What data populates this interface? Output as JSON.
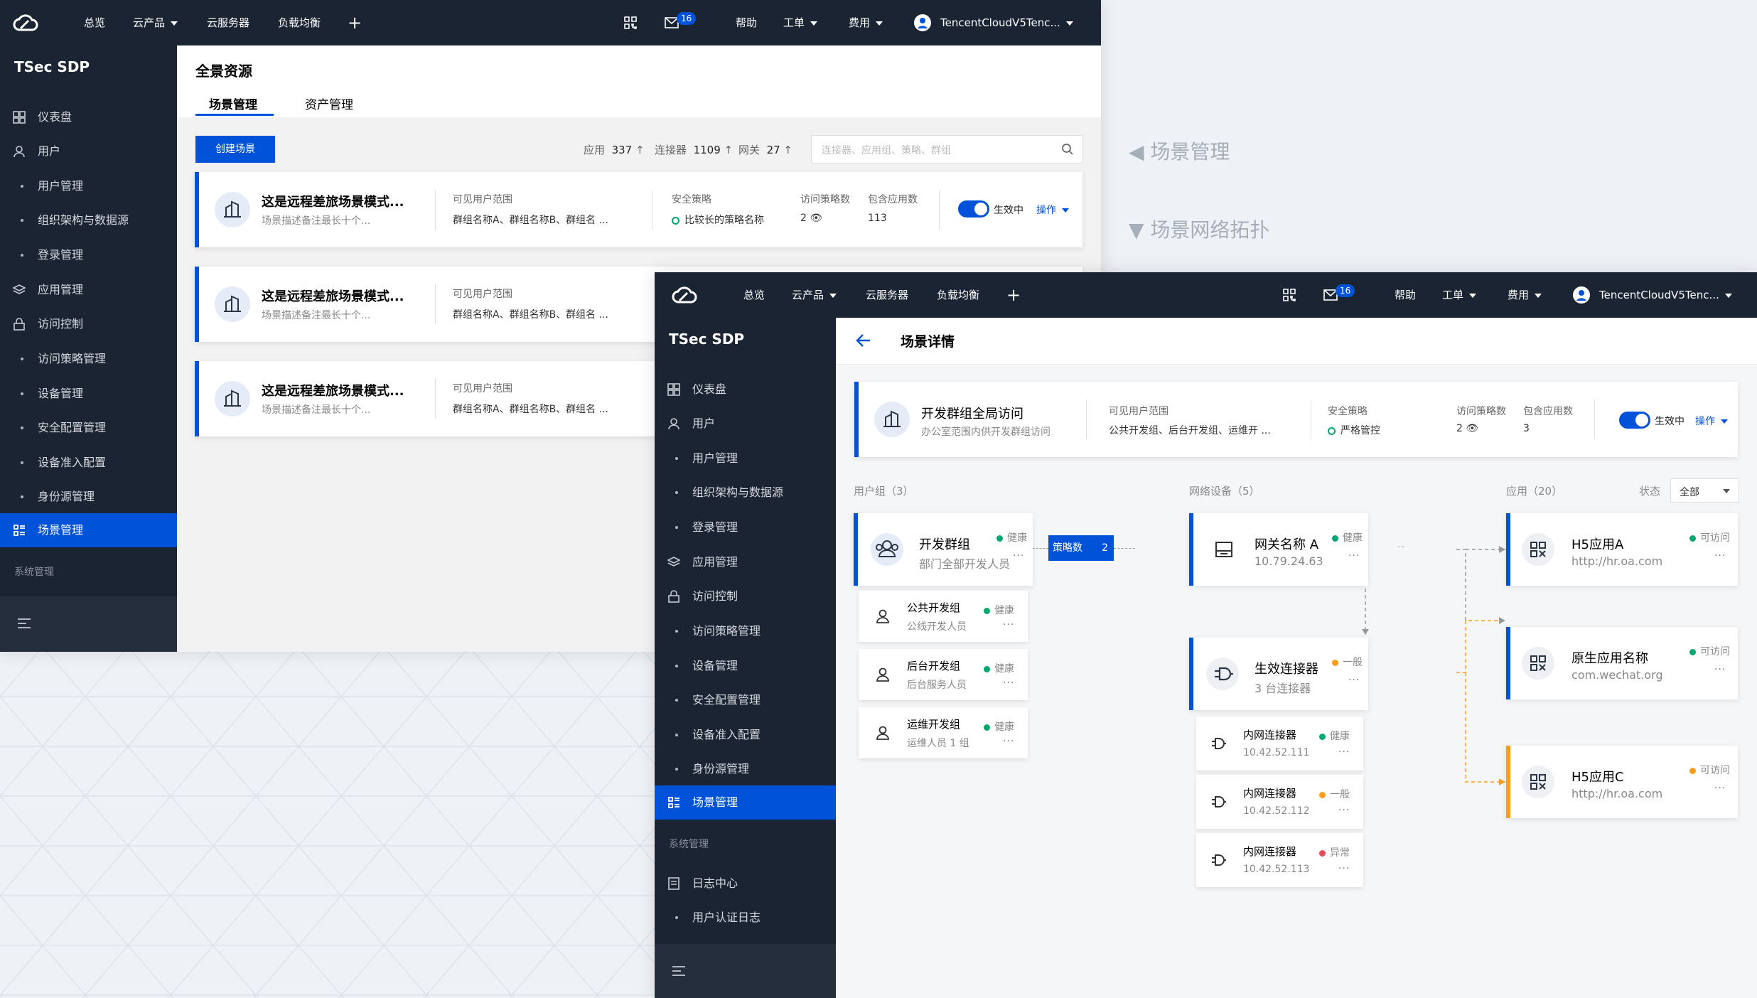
{
  "notes": {
    "scene_mgmt": "◀ 场景管理",
    "topology": "▼ 场景网络拓扑"
  },
  "topbar": {
    "overview": "总览",
    "products": "云产品",
    "servers": "云服务器",
    "lb": "负载均衡",
    "mail_count": "16",
    "help": "帮助",
    "tickets": "工单",
    "fees": "费用",
    "account": "TencentCloudV5Tenc..."
  },
  "sidebar": {
    "title": "TSec SDP",
    "items": [
      {
        "label": "仪表盘",
        "icon": "dashboard-icon"
      },
      {
        "label": "用户",
        "icon": "user-icon"
      },
      {
        "label": "用户管理"
      },
      {
        "label": "组织架构与数据源"
      },
      {
        "label": "登录管理"
      },
      {
        "label": "应用管理",
        "icon": "layers-icon"
      },
      {
        "label": "访问控制",
        "icon": "lock-icon"
      },
      {
        "label": "访问策略管理"
      },
      {
        "label": "设备管理"
      },
      {
        "label": "安全配置管理"
      },
      {
        "label": "设备准入配置"
      },
      {
        "label": "身份源管理"
      },
      {
        "label": "场景管理",
        "icon": "scene-icon"
      }
    ],
    "section": "系统管理",
    "sys_items": [
      {
        "label": "日志中心",
        "icon": "log-icon"
      },
      {
        "label": "用户认证日志"
      }
    ]
  },
  "overview_page": {
    "title": "全景资源",
    "tabs": [
      "场景管理",
      "资产管理"
    ],
    "create_button": "创建场景",
    "stats": [
      {
        "label": "应用",
        "value": "337"
      },
      {
        "label": "连接器",
        "value": "1109"
      },
      {
        "label": "网关",
        "value": "27"
      }
    ],
    "search_placeholder": "连接器、应用组、策略、群组",
    "scene_cards": [
      {
        "name": "这是远程差旅场景模式...",
        "desc": "场景描述备注最长十个...",
        "users_label": "可见用户范围",
        "users": "群组名称A、群组名称B、群组名 ...",
        "policy_label": "安全策略",
        "policy": "比较长的策略名称",
        "rules_label": "访问策略数",
        "rules": "2",
        "apps_label": "包含应用数",
        "apps": "113",
        "state": "生效中",
        "action": "操作"
      },
      {
        "name": "这是远程差旅场景模式...",
        "desc": "场景描述备注最长十个...",
        "users_label": "可见用户范围",
        "users": "群组名称A、群组名称B、群组名 ..."
      },
      {
        "name": "这是远程差旅场景模式...",
        "desc": "场景描述备注最长十个...",
        "users_label": "可见用户范围",
        "users": "群组名称A、群组名称B、群组名 ..."
      }
    ]
  },
  "detail_page": {
    "title": "场景详情",
    "scene": {
      "name": "开发群组全局访问",
      "desc": "办公室范围内供开发群组访问",
      "users_label": "可见用户范围",
      "users": "公共开发组、后台开发组、运维开 ...",
      "policy_label": "安全策略",
      "policy": "严格管控",
      "rules_label": "访问策略数",
      "rules": "2",
      "apps_label": "包含应用数",
      "apps": "3",
      "state": "生效中",
      "action": "操作"
    },
    "col_users": "用户组（3）",
    "col_net": "网络设备（5）",
    "col_apps": "应用（20）",
    "state_filter_label": "状态",
    "state_filter_value": "全部",
    "policy_tag": "策略数",
    "policy_count": "2",
    "user_group": {
      "name": "开发群组",
      "desc": "部门全部开发人员",
      "status": "健康"
    },
    "sub_groups": [
      {
        "name": "公共开发组",
        "desc": "公线开发人员",
        "status": "健康"
      },
      {
        "name": "后台开发组",
        "desc": "后台服务人员",
        "status": "健康"
      },
      {
        "name": "运维开发组",
        "desc": "运维人员 1 组",
        "status": "健康"
      }
    ],
    "gateway": {
      "name": "网关名称 A",
      "ip": "10.79.24.63",
      "status": "健康"
    },
    "connector": {
      "name": "生效连接器",
      "desc": "3 台连接器",
      "status": "一般"
    },
    "sub_connectors": [
      {
        "name": "内网连接器",
        "ip": "10.42.52.111",
        "status": "健康"
      },
      {
        "name": "内网连接器",
        "ip": "10.42.52.112",
        "status": "一般"
      },
      {
        "name": "内网连接器",
        "ip": "10.42.52.113",
        "status": "异常"
      }
    ],
    "apps": [
      {
        "name": "H5应用A",
        "url": "http://hr.oa.com",
        "status": "可访问"
      },
      {
        "name": "原生应用名称",
        "url": "com.wechat.org",
        "status": "可访问"
      },
      {
        "name": "H5应用C",
        "url": "http://hr.oa.com",
        "status": "可访问"
      }
    ],
    "colors": {
      "primary": "#0052d9",
      "healthy": "#00a870",
      "warning": "#ff9c19",
      "error": "#e34d59"
    }
  }
}
